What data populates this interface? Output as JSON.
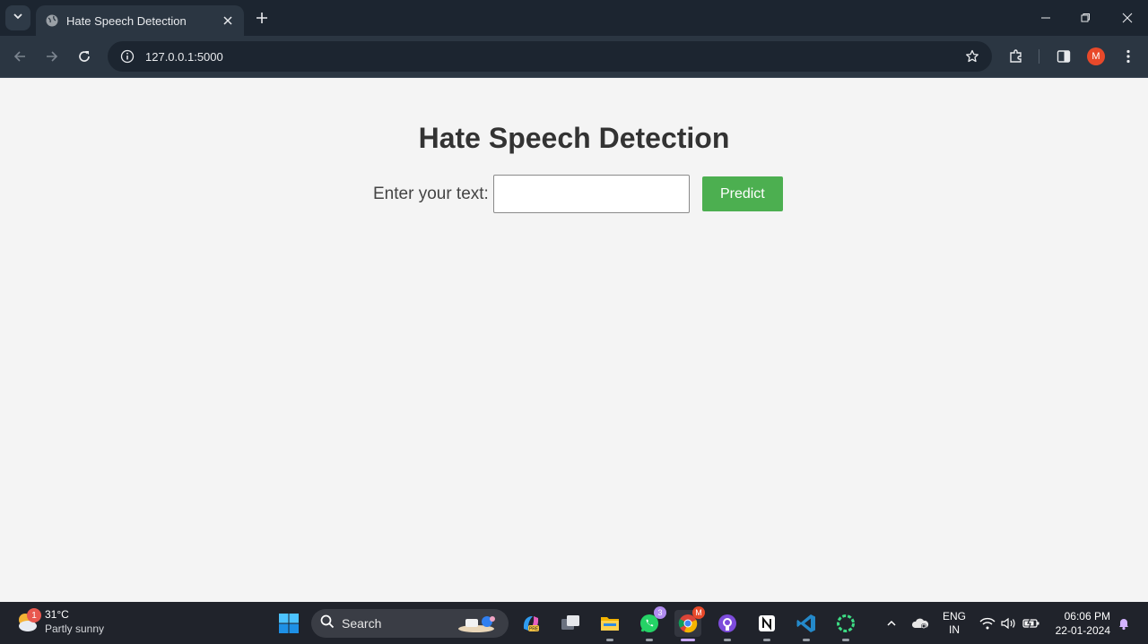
{
  "browser": {
    "tab_title": "Hate Speech Detection",
    "url": "127.0.0.1:5000",
    "profile_initial": "M"
  },
  "page": {
    "title": "Hate Speech Detection",
    "input_label": "Enter your text:",
    "input_value": "",
    "predict_label": "Predict",
    "accent": "#4caf50"
  },
  "taskbar": {
    "weather": {
      "temp": "31°C",
      "condition": "Partly sunny",
      "badge": "1"
    },
    "search_label": "Search",
    "apps": [
      {
        "name": "copilot-icon"
      },
      {
        "name": "task-view-icon"
      },
      {
        "name": "file-explorer-icon"
      },
      {
        "name": "whatsapp-icon",
        "badge": "3"
      },
      {
        "name": "chrome-icon",
        "badge": "M"
      },
      {
        "name": "github-desktop-icon"
      },
      {
        "name": "notion-icon"
      },
      {
        "name": "vscode-icon"
      },
      {
        "name": "loading-app-icon"
      }
    ],
    "language": {
      "line1": "ENG",
      "line2": "IN"
    },
    "clock": {
      "time": "06:06 PM",
      "date": "22-01-2024"
    }
  }
}
